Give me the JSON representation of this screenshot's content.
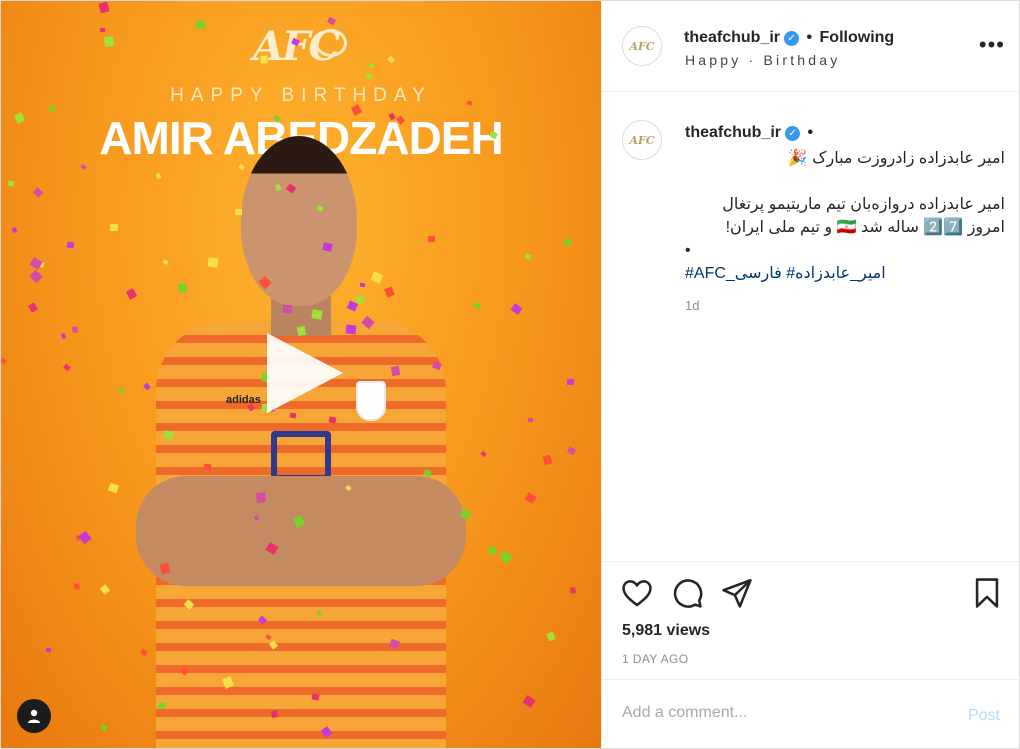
{
  "media": {
    "logo_text": "AFC",
    "subtitle": "HAPPY BIRTHDAY",
    "name": "AMIR ABEDZADEH",
    "jersey_brand": "adidas"
  },
  "header": {
    "username": "theafchub_ir",
    "separator": "•",
    "follow_status": "Following",
    "subtitle": "Happy · Birthday",
    "avatar_text": "AFC"
  },
  "caption": {
    "username": "theafchub_ir",
    "separator": "•",
    "avatar_text": "AFC",
    "line1": "امیر عابدزاده زادروزت مبارک 🎉",
    "line2": "امیر عابدزاده دروازه‌بان تیم ماریتیمو پرتغال",
    "line3": "امروز 2️⃣7️⃣ ساله شد 🇮🇷 و تیم ملی ایران!",
    "line4": "•",
    "hashtags": "#AFC_امیر_عابدزاده# فارسی",
    "time": "1d"
  },
  "actions": {
    "icons": [
      "heart-icon",
      "comment-icon",
      "share-icon",
      "bookmark-icon"
    ],
    "views": "5,981 views",
    "ago": "1 DAY AGO"
  },
  "comment": {
    "placeholder": "Add a comment...",
    "post_label": "Post"
  },
  "colors": {
    "accent": "#3897f0",
    "link": "#00376b",
    "muted": "#8e8e8e",
    "post_disabled": "#b3dbff",
    "media_bg": "#f6961c"
  }
}
